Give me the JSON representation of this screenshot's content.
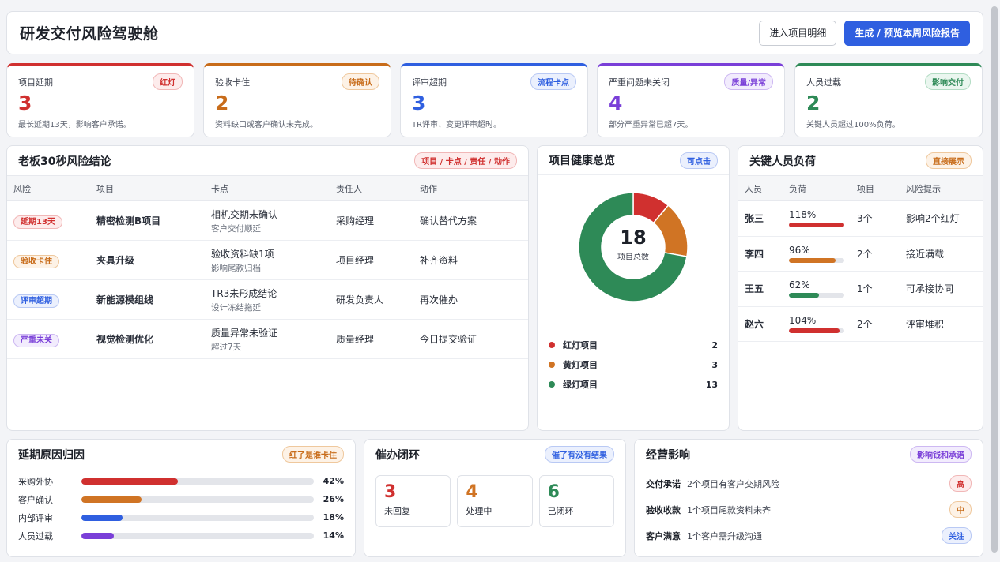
{
  "header": {
    "title": "研发交付风险驾驶舱",
    "btn_detail": "进入项目明细",
    "btn_report": "生成 / 预览本周风险报告"
  },
  "kpis": [
    {
      "label": "项目延期",
      "badge": "红灯",
      "value": "3",
      "desc": "最长延期13天，影响客户承诺。",
      "color": "#d0302f"
    },
    {
      "label": "验收卡住",
      "badge": "待确认",
      "value": "2",
      "desc": "资料缺口或客户确认未完成。",
      "color": "#c86c1a"
    },
    {
      "label": "评审超期",
      "badge": "流程卡点",
      "value": "3",
      "desc": "TR评审、变更评审超时。",
      "color": "#2f5fe0"
    },
    {
      "label": "严重问题未关闭",
      "badge": "质量/异常",
      "value": "4",
      "desc": "部分严重异常已超7天。",
      "color": "#7a3fd8"
    },
    {
      "label": "人员过载",
      "badge": "影响交付",
      "value": "2",
      "desc": "关键人员超过100%负荷。",
      "color": "#2e8a57"
    }
  ],
  "risk_table": {
    "title": "老板30秒风险结论",
    "badge": "项目 / 卡点 / 责任 / 动作",
    "columns": [
      "风险",
      "项目",
      "卡点",
      "责任人",
      "动作"
    ],
    "rows": [
      {
        "tag": "延期13天",
        "project": "精密检测B项目",
        "block": "相机交期未确认",
        "block_sub": "客户交付顺延",
        "owner": "采购经理",
        "action": "确认替代方案"
      },
      {
        "tag": "验收卡住",
        "project": "夹具升级",
        "block": "验收资料缺1项",
        "block_sub": "影响尾款归档",
        "owner": "项目经理",
        "action": "补齐资料"
      },
      {
        "tag": "评审超期",
        "project": "新能源模组线",
        "block": "TR3未形成结论",
        "block_sub": "设计冻结拖延",
        "owner": "研发负责人",
        "action": "再次催办"
      },
      {
        "tag": "严重未关",
        "project": "视觉检测优化",
        "block": "质量异常未验证",
        "block_sub": "超过7天",
        "owner": "质量经理",
        "action": "今日提交验证"
      }
    ]
  },
  "health": {
    "title": "项目健康总览",
    "badge": "可点击",
    "total": "18",
    "total_label": "项目总数",
    "legend": [
      {
        "name": "红灯项目",
        "value": 2,
        "color": "#d0302f"
      },
      {
        "name": "黄灯项目",
        "value": 3,
        "color": "#d07424"
      },
      {
        "name": "绿灯项目",
        "value": 13,
        "color": "#2e8a57"
      }
    ]
  },
  "people": {
    "title": "关键人员负荷",
    "badge": "直接展示",
    "columns": [
      "人员",
      "负荷",
      "项目",
      "风险提示"
    ],
    "rows": [
      {
        "name": "张三",
        "load": "118%",
        "load_pct": 118,
        "color": "#d0302f",
        "projects": "3个",
        "hint": "影响2个红灯"
      },
      {
        "name": "李四",
        "load": "96%",
        "load_pct": 96,
        "color": "#d07424",
        "projects": "2个",
        "hint": "接近满载"
      },
      {
        "name": "王五",
        "load": "62%",
        "load_pct": 62,
        "color": "#2e8a57",
        "projects": "1个",
        "hint": "可承接协同"
      },
      {
        "name": "赵六",
        "load": "104%",
        "load_pct": 104,
        "color": "#d0302f",
        "projects": "2个",
        "hint": "评审堆积"
      }
    ]
  },
  "causes": {
    "title": "延期原因归因",
    "badge": "红了是谁卡住",
    "items": [
      {
        "name": "采购外协",
        "pct": "42%",
        "value": 42,
        "color": "#d0302f"
      },
      {
        "name": "客户确认",
        "pct": "26%",
        "value": 26,
        "color": "#d07424"
      },
      {
        "name": "内部评审",
        "pct": "18%",
        "value": 18,
        "color": "#2f5fe0"
      },
      {
        "name": "人员过载",
        "pct": "14%",
        "value": 14,
        "color": "#7a3fd8"
      }
    ]
  },
  "chase": {
    "title": "催办闭环",
    "badge": "催了有没有结果",
    "items": [
      {
        "num": "3",
        "label": "未回复",
        "color": "#d0302f"
      },
      {
        "num": "4",
        "label": "处理中",
        "color": "#d07424"
      },
      {
        "num": "6",
        "label": "已闭环",
        "color": "#2e8a57"
      }
    ]
  },
  "impact": {
    "title": "经营影响",
    "badge": "影响钱和承诺",
    "items": [
      {
        "key": "交付承诺",
        "text": "2个项目有客户交期风险",
        "level": "高"
      },
      {
        "key": "验收收款",
        "text": "1个项目尾款资料未齐",
        "level": "中"
      },
      {
        "key": "客户满意",
        "text": "1个客户需升级沟通",
        "level": "关注"
      }
    ]
  }
}
